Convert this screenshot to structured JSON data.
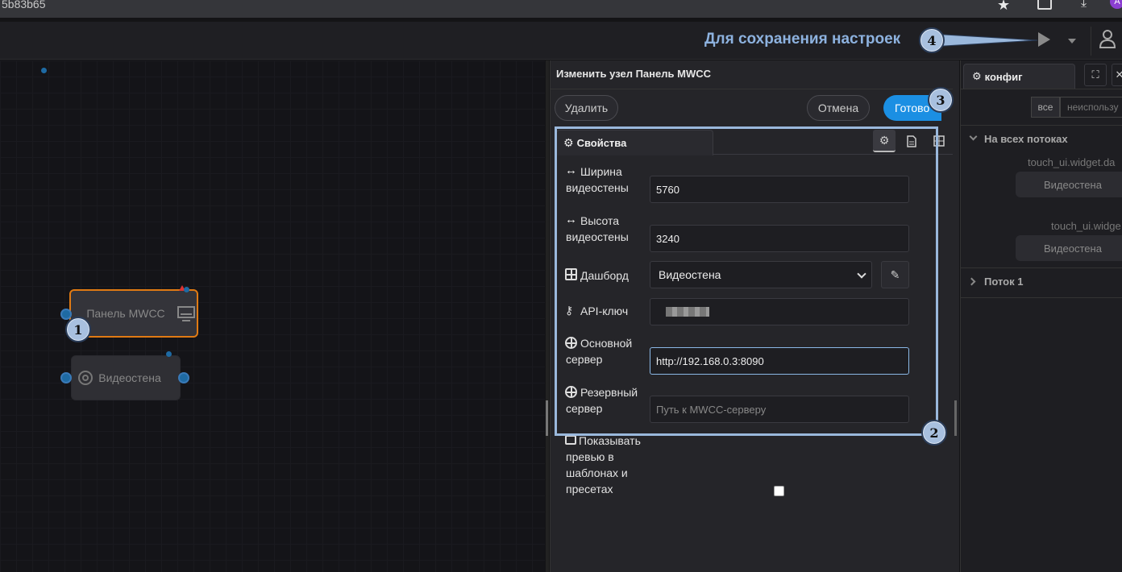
{
  "browser": {
    "url_fragment": "5b83b65",
    "star_icon": "star-icon",
    "extensions_icon": "puzzle-icon",
    "download_icon": "download-icon",
    "profile_letter": "A"
  },
  "header": {
    "annotation": "Для сохранения настроек",
    "badge4": "4"
  },
  "canvas": {
    "node1": "Панель MWCC",
    "node2": "Видеостена",
    "badge1": "1"
  },
  "editor": {
    "title": "Изменить узел Панель MWCC",
    "delete_label": "Удалить",
    "cancel_label": "Отмена",
    "done_label": "Готово",
    "badge3": "3",
    "badge2": "2",
    "tab_label": "Свойства",
    "fields": {
      "width_label": "Ширина видеостены",
      "width_value": "5760",
      "height_label": "Высота видеостены",
      "height_value": "3240",
      "dashboard_label": "Дашборд",
      "dashboard_value": "Видеостена",
      "apikey_label": "API-ключ",
      "primary_label": "Основной сервер",
      "primary_value": "http://192.168.0.3:8090",
      "backup_label": "Резервный сервер",
      "backup_placeholder": "Путь к MWCC-серверу",
      "preview_label": "Показывать превью в шаблонах и пресетах"
    }
  },
  "sidebar": {
    "tab_label": "конфиг",
    "filter_all": "все",
    "filter_unused": "неиспользу",
    "section_all": "На всех потоках",
    "item1_type": "touch_ui.widget.da",
    "item1_name": "Видеостена",
    "item2_type": "touch_ui.widge",
    "item2_name": "Видеостена",
    "section_flow": "Поток 1"
  },
  "colors": {
    "accent": "#1b8fe3",
    "annotation": "#8db2df",
    "port": "#1e6aa3",
    "node_selected_border": "#e07a13"
  }
}
